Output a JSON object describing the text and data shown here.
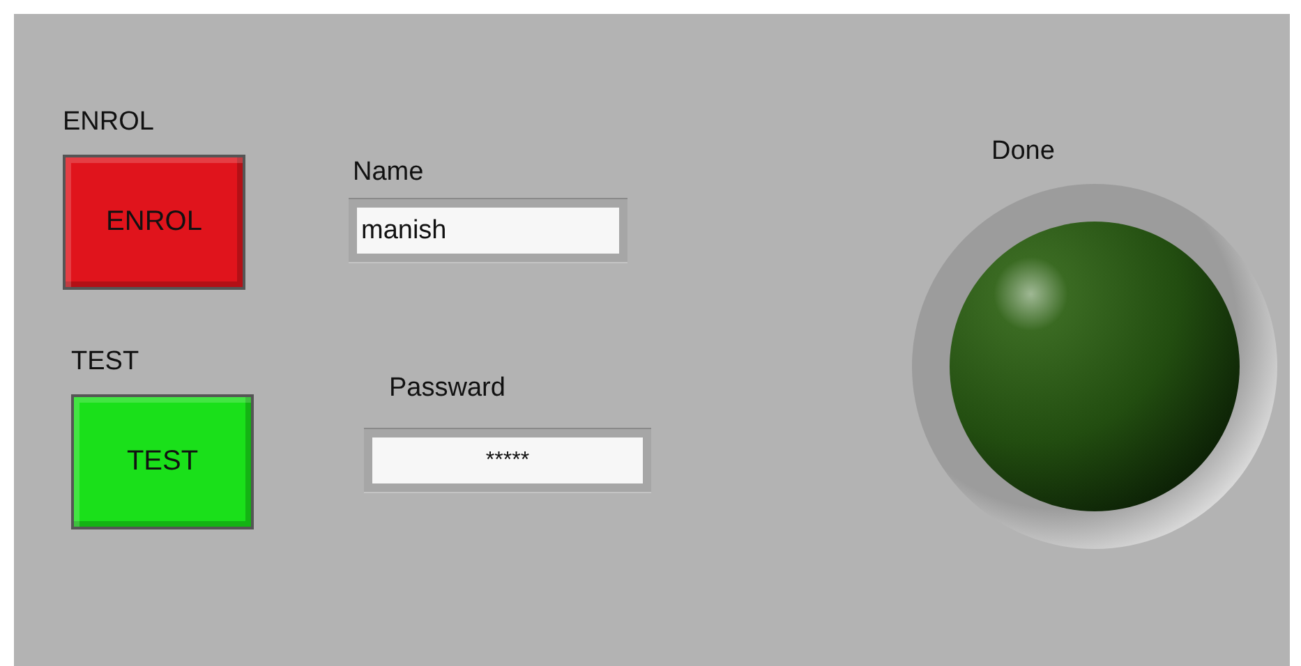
{
  "buttons": [
    {
      "label": "ENROL",
      "caption": "ENROL",
      "color": "#e0141c"
    },
    {
      "label": "TEST",
      "caption": "TEST",
      "color": "#1ae01a"
    }
  ],
  "fields": [
    {
      "label": "Name",
      "value": "manish",
      "kind": "text"
    },
    {
      "label": "Passward",
      "value": "*****",
      "kind": "password"
    }
  ],
  "indicator": {
    "label": "Done",
    "on": false
  }
}
